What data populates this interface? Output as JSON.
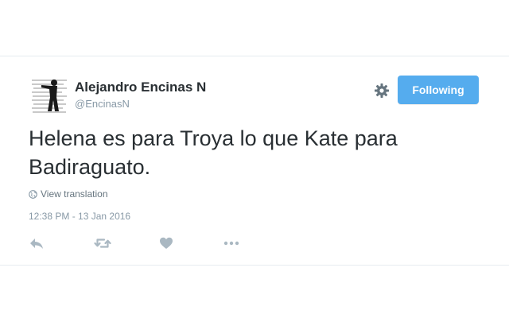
{
  "tweet": {
    "display_name": "Alejandro Encinas N",
    "screen_name": "@EncinasN",
    "text": "Helena es para Troya lo que Kate para Badiraguato.",
    "translation_link": "View translation",
    "timestamp": "12:38 PM - 13 Jan 2016"
  },
  "header": {
    "follow_button_label": "Following"
  },
  "icons": {
    "settings": "gear-icon",
    "translation": "globe-icon",
    "reply": "reply-icon",
    "retweet": "retweet-icon",
    "like": "heart-icon",
    "more": "more-icon"
  },
  "colors": {
    "accent": "#55acee",
    "text_primary": "#292f33",
    "text_secondary": "#8899a6",
    "icon_gray": "#aab8c2"
  }
}
